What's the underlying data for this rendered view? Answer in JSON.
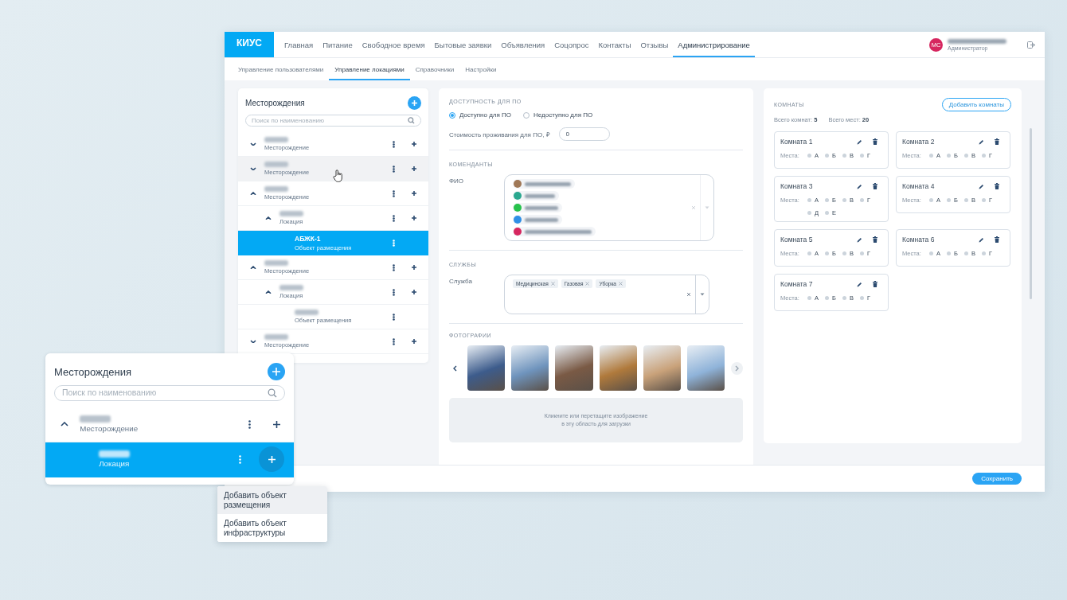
{
  "nav": {
    "logo": "КИУС",
    "items": [
      {
        "label": "Главная",
        "selected": false
      },
      {
        "label": "Питание",
        "selected": false
      },
      {
        "label": "Свободное время",
        "selected": false
      },
      {
        "label": "Бытовые заявки",
        "selected": false
      },
      {
        "label": "Объявления",
        "selected": false
      },
      {
        "label": "Соцопрос",
        "selected": false
      },
      {
        "label": "Контакты",
        "selected": false
      },
      {
        "label": "Отзывы",
        "selected": false
      },
      {
        "label": "Администрирование",
        "selected": true
      }
    ],
    "user": {
      "initials": "МС",
      "role": "Администратор"
    }
  },
  "subtabs": [
    {
      "label": "Управление пользователями",
      "selected": false
    },
    {
      "label": "Управление локациями",
      "selected": true
    },
    {
      "label": "Справочники",
      "selected": false
    },
    {
      "label": "Настройки",
      "selected": false
    }
  ],
  "tree": {
    "title": "Месторождения",
    "search_placeholder": "Поиск по наименованию",
    "items": [
      {
        "kind": "branch",
        "type": "Месторождение",
        "expanded": false,
        "selected": false,
        "hovered": false
      },
      {
        "kind": "branch",
        "type": "Месторождение",
        "expanded": false,
        "selected": false,
        "hovered": true
      },
      {
        "kind": "branch",
        "type": "Месторождение",
        "expanded": true,
        "selected": false,
        "hovered": false,
        "children": [
          {
            "kind": "branch",
            "type": "Локация",
            "expanded": true,
            "selected": false,
            "hovered": false,
            "children": [
              {
                "kind": "leaf",
                "name": "АБЖК-1",
                "type": "Объект размещения",
                "selected": true,
                "hovered": false
              }
            ]
          }
        ]
      },
      {
        "kind": "branch",
        "type": "Месторождение",
        "expanded": true,
        "selected": false,
        "hovered": false,
        "children": [
          {
            "kind": "branch",
            "type": "Локация",
            "expanded": true,
            "selected": false,
            "hovered": false,
            "children": [
              {
                "kind": "leaf",
                "type": "Объект размещения",
                "selected": false,
                "hovered": false
              }
            ]
          }
        ]
      },
      {
        "kind": "branch",
        "type": "Месторождение",
        "expanded": false,
        "selected": false,
        "hovered": false
      }
    ]
  },
  "availability": {
    "heading": "ДОСТУПНОСТЬ ДЛЯ ПО",
    "options": [
      {
        "label": "Доступно для ПО",
        "selected": true
      },
      {
        "label": "Недоступно для ПО",
        "selected": false
      }
    ],
    "cost_label": "Стоимость проживания для ПО, ₽",
    "cost_value": "0"
  },
  "commandants": {
    "heading": "КОМЕНДАНТЫ",
    "label": "ФИО",
    "people": [
      {
        "color": "#a07856"
      },
      {
        "color": "#2aa88f"
      },
      {
        "color": "#27c24c"
      },
      {
        "color": "#2f8fe6"
      },
      {
        "color": "#d6265f"
      }
    ]
  },
  "services": {
    "heading": "СЛУЖБЫ",
    "label": "Служба",
    "tags": [
      "Медицинская",
      "Газовая",
      "Уборка"
    ]
  },
  "photos": {
    "heading": "ФОТОГРАФИИ",
    "items": [
      {
        "color": "#3d5c8c"
      },
      {
        "color": "#6f94bd"
      },
      {
        "color": "#7a5a45"
      },
      {
        "color": "#b07a3c"
      },
      {
        "color": "#c9a27a"
      },
      {
        "color": "#8fb3d9"
      }
    ],
    "dropzone": [
      "Кликните или перетащите изображение",
      "в эту область для загрузки"
    ]
  },
  "rooms": {
    "heading": "КОМНАТЫ",
    "add_button": "Добавить комнаты",
    "total_rooms_label": "Всего комнат:",
    "total_rooms": "5",
    "total_seats_label": "Всего мест:",
    "total_seats": "20",
    "items": [
      {
        "name": "Комната 1",
        "seats_label": "Места:",
        "seats": [
          "А",
          "Б",
          "В",
          "Г"
        ]
      },
      {
        "name": "Комната 2",
        "seats_label": "Места:",
        "seats": [
          "А",
          "Б",
          "В",
          "Г"
        ]
      },
      {
        "name": "Комната 3",
        "seats_label": "Места:",
        "seats": [
          "А",
          "Б",
          "В",
          "Г",
          "Д",
          "Е"
        ]
      },
      {
        "name": "Комната 4",
        "seats_label": "Места:",
        "seats": [
          "А",
          "Б",
          "В",
          "Г"
        ]
      },
      {
        "name": "Комната 5",
        "seats_label": "Места:",
        "seats": [
          "А",
          "Б",
          "В",
          "Г"
        ]
      },
      {
        "name": "Комната 6",
        "seats_label": "Места:",
        "seats": [
          "А",
          "Б",
          "В",
          "Г"
        ]
      },
      {
        "name": "Комната 7",
        "seats_label": "Места:",
        "seats": [
          "А",
          "Б",
          "В",
          "Г"
        ]
      }
    ]
  },
  "save_button": "Сохранить",
  "popup_panel": {
    "title": "Месторождения",
    "search_placeholder": "Поиск по наименованию",
    "items": [
      {
        "kind": "branch",
        "type": "Месторождение",
        "expanded": true,
        "selected": false,
        "hovered": false,
        "children": [
          {
            "kind": "branch",
            "type": "Локация",
            "selected": true,
            "hovered": false
          }
        ]
      }
    ]
  },
  "context_menu": {
    "items": [
      {
        "label": "Добавить объект размещения",
        "selected": true
      },
      {
        "label": "Добавить объект инфраструктуры",
        "selected": false
      }
    ]
  }
}
